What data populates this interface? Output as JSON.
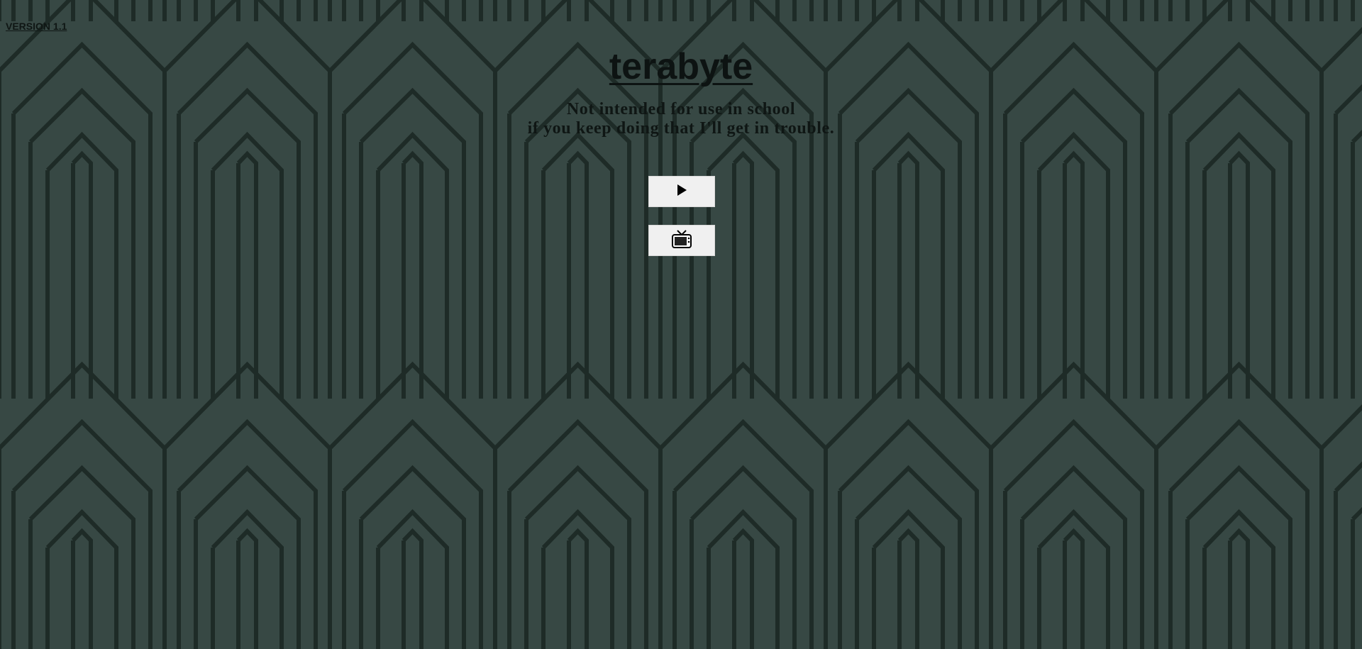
{
  "version_label": "VERSION 1.1",
  "title": "terabyte",
  "subtitle": {
    "line1": "Not intended for use in school",
    "line2": "if you keep doing that I'll get in trouble."
  },
  "buttons": [
    {
      "icon": "play-icon"
    },
    {
      "icon": "tv-icon"
    }
  ],
  "colors": {
    "background": "#374844",
    "pattern_line": "#1a2622",
    "text": "#0f1614",
    "button_bg": "#f0f0f0"
  }
}
